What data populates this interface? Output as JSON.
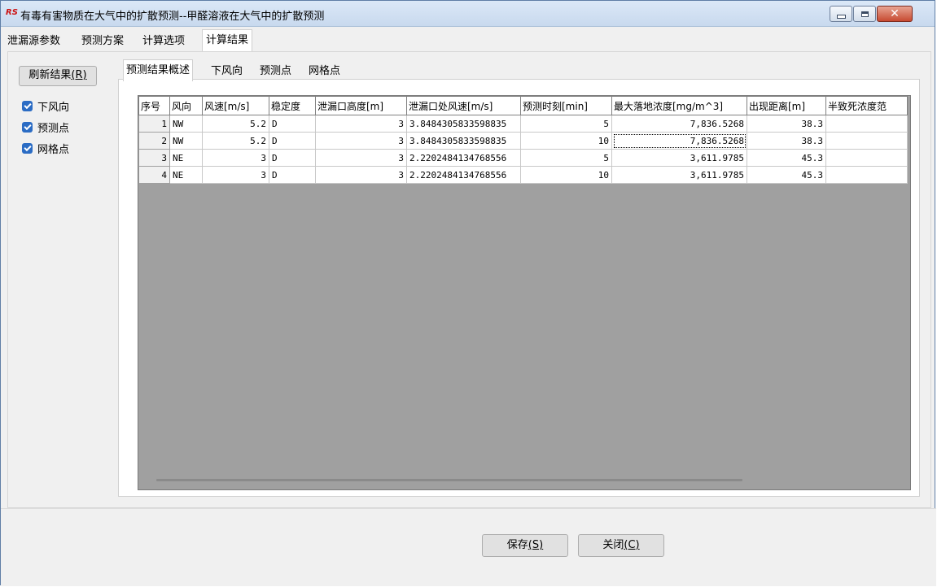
{
  "window": {
    "icon": "rs-app-icon",
    "title": "有毒有害物质在大气中的扩散预测--甲醛溶液在大气中的扩散预测"
  },
  "top_tabs": [
    {
      "label": "泄漏源参数",
      "active": false
    },
    {
      "label": "预测方案",
      "active": false
    },
    {
      "label": "计算选项",
      "active": false
    },
    {
      "label": "计算结果",
      "active": true
    }
  ],
  "left_panel": {
    "refresh_label": "刷新结果",
    "refresh_hotkey": "(R)",
    "checkboxes": [
      {
        "label": "下风向",
        "checked": true
      },
      {
        "label": "预测点",
        "checked": true
      },
      {
        "label": "网格点",
        "checked": true
      }
    ]
  },
  "sub_tabs": [
    {
      "label": "预测结果概述",
      "active": true
    },
    {
      "label": "下风向",
      "active": false
    },
    {
      "label": "预测点",
      "active": false
    },
    {
      "label": "网格点",
      "active": false
    }
  ],
  "table": {
    "columns": [
      "序号",
      "风向",
      "风速[m/s]",
      "稳定度",
      "泄漏口高度[m]",
      "泄漏口处风速[m/s]",
      "预测时刻[min]",
      "最大落地浓度[mg/m^3]",
      "出现距离[m]",
      "半致死浓度范"
    ],
    "rows": [
      [
        "1",
        "NW",
        "5.2",
        "D",
        "3",
        "3.8484305833598835",
        "5",
        "7,836.5268",
        "38.3",
        ""
      ],
      [
        "2",
        "NW",
        "5.2",
        "D",
        "3",
        "3.8484305833598835",
        "10",
        "7,836.5268",
        "38.3",
        ""
      ],
      [
        "3",
        "NE",
        "3",
        "D",
        "3",
        "2.2202484134768556",
        "5",
        "3,611.9785",
        "45.3",
        ""
      ],
      [
        "4",
        "NE",
        "3",
        "D",
        "3",
        "2.2202484134768556",
        "10",
        "3,611.9785",
        "45.3",
        ""
      ]
    ]
  },
  "buttons": {
    "save_label": "保存",
    "save_hotkey": "(S)",
    "close_label": "关闭",
    "close_hotkey": "(C)"
  }
}
